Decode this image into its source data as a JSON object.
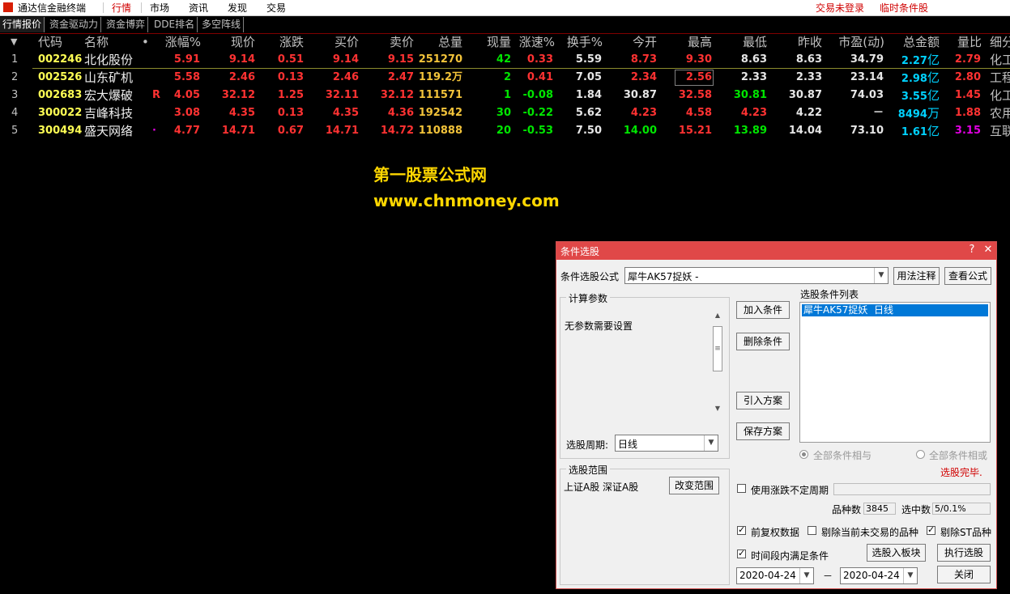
{
  "app": {
    "title": "通达信金融终端",
    "menus": [
      "行情",
      "市场",
      "资讯",
      "发现",
      "交易"
    ],
    "status_login": "交易未登录",
    "status_condition": "临时条件股",
    "accent_color": "#d81e06"
  },
  "tabs": [
    "行情报价",
    "资金驱动力",
    "资金博弈",
    "DDE排名",
    "多空阵线"
  ],
  "table": {
    "sort_arrow": "▼",
    "columns": [
      "代码",
      "名称",
      "•",
      "涨幅%",
      "现价",
      "涨跌",
      "买价",
      "卖价",
      "总量",
      "现量",
      "涨速%",
      "换手%",
      "今开",
      "最高",
      "最低",
      "昨收",
      "市盈(动)",
      "总金额",
      "量比",
      "细分"
    ],
    "rows": [
      {
        "idx": "1",
        "code": "002246",
        "name": "北化股份",
        "flag": "",
        "chg_pct": "5.91",
        "price": "9.14",
        "chg": "0.51",
        "bid": "9.14",
        "ask": "9.15",
        "vol": "251270",
        "cur_vol": "42",
        "speed": "0.33",
        "turnover": "5.59",
        "open": "8.73",
        "high": "9.30",
        "low": "8.63",
        "prev": "8.63",
        "pe": "34.79",
        "amt_num": "2.27",
        "amt_unit": "亿",
        "vol_ratio": "2.79",
        "industry": "化工"
      },
      {
        "idx": "2",
        "code": "002526",
        "name": "山东矿机",
        "flag": "",
        "chg_pct": "5.58",
        "price": "2.46",
        "chg": "0.13",
        "bid": "2.46",
        "ask": "2.47",
        "vol": "119.2万",
        "cur_vol": "2",
        "speed": "0.41",
        "turnover": "7.05",
        "open": "2.34",
        "high": "2.56",
        "low": "2.33",
        "prev": "2.33",
        "pe": "23.14",
        "amt_num": "2.98",
        "amt_unit": "亿",
        "vol_ratio": "2.80",
        "industry": "工程"
      },
      {
        "idx": "3",
        "code": "002683",
        "name": "宏大爆破",
        "flag": "R",
        "chg_pct": "4.05",
        "price": "32.12",
        "chg": "1.25",
        "bid": "32.11",
        "ask": "32.12",
        "vol": "111571",
        "cur_vol": "1",
        "speed": "-0.08",
        "turnover": "1.84",
        "open": "30.87",
        "high": "32.58",
        "low": "30.81",
        "prev": "30.87",
        "pe": "74.03",
        "amt_num": "3.55",
        "amt_unit": "亿",
        "vol_ratio": "1.45",
        "industry": "化工"
      },
      {
        "idx": "4",
        "code": "300022",
        "name": "吉峰科技",
        "flag": "",
        "chg_pct": "3.08",
        "price": "4.35",
        "chg": "0.13",
        "bid": "4.35",
        "ask": "4.36",
        "vol": "192542",
        "cur_vol": "30",
        "speed": "-0.22",
        "turnover": "5.62",
        "open": "4.23",
        "high": "4.58",
        "low": "4.23",
        "prev": "4.22",
        "pe": "－",
        "amt_num": "8494",
        "amt_unit": "万",
        "vol_ratio": "1.88",
        "industry": "农用"
      },
      {
        "idx": "5",
        "code": "300494",
        "name": "盛天网络",
        "flag": "·",
        "chg_pct": "4.77",
        "price": "14.71",
        "chg": "0.67",
        "bid": "14.71",
        "ask": "14.72",
        "vol": "110888",
        "cur_vol": "20",
        "speed": "-0.53",
        "turnover": "7.50",
        "open": "14.00",
        "high": "15.21",
        "low": "13.89",
        "prev": "14.04",
        "pe": "73.10",
        "amt_num": "1.61",
        "amt_unit": "亿",
        "vol_ratio": "3.15",
        "industry": "互联"
      }
    ]
  },
  "watermark": {
    "line1": "第一股票公式网",
    "line2": "www.chnmoney.com"
  },
  "dialog": {
    "title": "条件选股",
    "formula_label": "条件选股公式",
    "formula_value": "犀牛AK57捉妖 -",
    "usage_button": "用法注释",
    "view_formula_button": "查看公式",
    "params_group": "计算参数",
    "params_text": "无参数需要设置",
    "period_label": "选股周期:",
    "period_value": "日线",
    "add_button": "加入条件",
    "delete_button": "删除条件",
    "import_button": "引入方案",
    "save_button": "保存方案",
    "list_title": "选股条件列表",
    "list_items": [
      "犀牛AK57捉妖  日线"
    ],
    "radio_and": "全部条件相与",
    "radio_or": "全部条件相或",
    "done_text": "选股完毕.",
    "range_group": "选股范围",
    "range_text": "上证A股  深证A股",
    "change_range_button": "改变范围",
    "use_limit_label": "使用涨跌不定周期",
    "count_label": "品种数",
    "count_value": "3845",
    "selected_label": "选中数",
    "selected_value": "5/0.1%",
    "fq_label": "前复权数据",
    "exclude_untraded_label": "剔除当前未交易的品种",
    "exclude_st_label": "剔除ST品种",
    "period_cond_label": "时间段内满足条件",
    "to_block_button": "选股入板块",
    "execute_button": "执行选股",
    "date_from": "2020-04-24",
    "date_to": "2020-04-24",
    "date_sep": "－",
    "close_button": "关闭",
    "checked_mark": "✓"
  }
}
